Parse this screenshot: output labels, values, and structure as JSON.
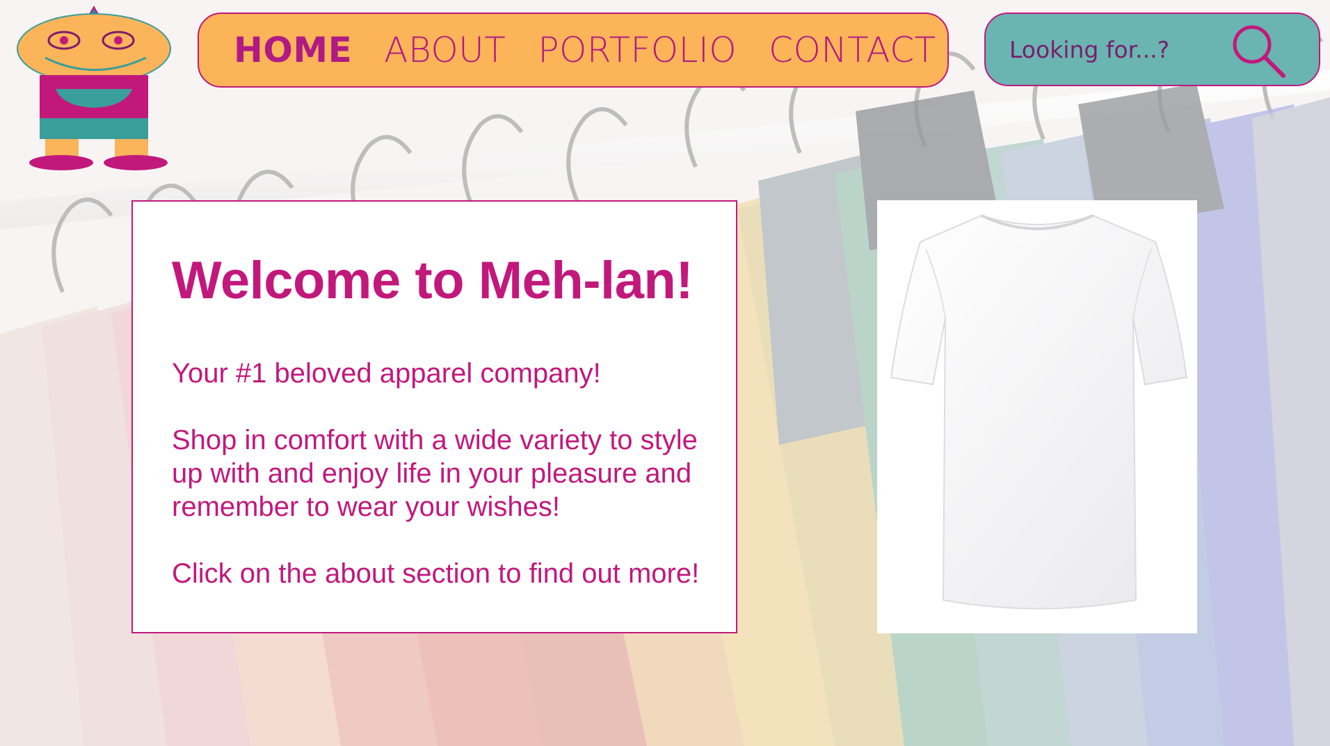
{
  "brand": {
    "logo_icon": "robot-mascot-icon"
  },
  "nav": {
    "items": [
      {
        "label": "HOME",
        "active": true
      },
      {
        "label": "ABOUT",
        "active": false
      },
      {
        "label": "PORTFOLIO",
        "active": false
      },
      {
        "label": "CONTACT",
        "active": false
      }
    ]
  },
  "search": {
    "placeholder": "Looking for...?",
    "icon": "search-icon"
  },
  "hero": {
    "title": "Welcome to Meh-lan!",
    "tagline": "Your #1 beloved apparel company!",
    "body": "Shop in comfort with a wide variety to style up with and enjoy life in your pleasure and remember to wear your wishes!",
    "cta": "Click on the about section to find out more!"
  },
  "product": {
    "image": "white-t-shirt"
  },
  "colors": {
    "accent": "#c2187c",
    "nav_bg": "#fcb458",
    "search_bg": "#6ab4b1"
  }
}
